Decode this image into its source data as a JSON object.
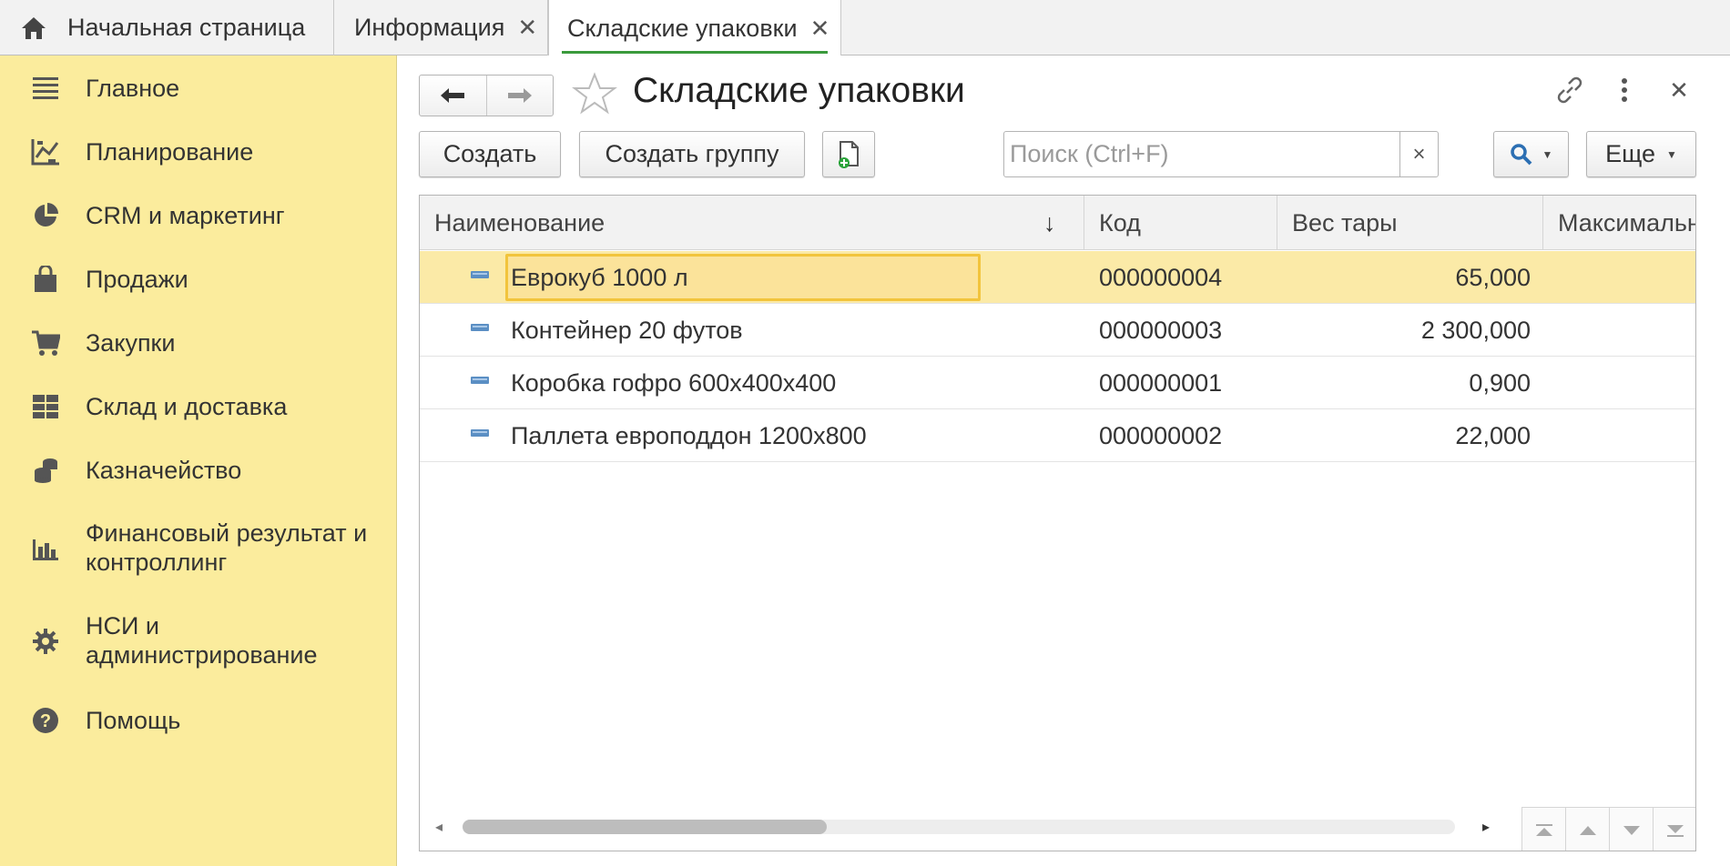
{
  "tabs": [
    {
      "label": "Начальная страница",
      "icon": "home-icon",
      "closable": false
    },
    {
      "label": "Информация",
      "closable": true
    },
    {
      "label": "Складские упаковки",
      "closable": true,
      "active": true
    }
  ],
  "sidebar": {
    "items": [
      {
        "label": "Главное",
        "icon": "menu-icon"
      },
      {
        "label": "Планирование",
        "icon": "planning-icon"
      },
      {
        "label": "CRM и маркетинг",
        "icon": "pie-chart-icon"
      },
      {
        "label": "Продажи",
        "icon": "shopping-bag-icon"
      },
      {
        "label": "Закупки",
        "icon": "cart-icon"
      },
      {
        "label": "Склад и доставка",
        "icon": "warehouse-grid-icon"
      },
      {
        "label": "Казначейство",
        "icon": "coins-icon"
      },
      {
        "label_line1": "Финансовый результат и",
        "label_line2": "контроллинг",
        "icon": "bar-chart-icon"
      },
      {
        "label_line1": "НСИ и",
        "label_line2": "администрирование",
        "icon": "gear-icon"
      },
      {
        "label": "Помощь",
        "icon": "help-icon"
      }
    ]
  },
  "form": {
    "title": "Складские упаковки",
    "create_label": "Создать",
    "create_group_label": "Создать группу",
    "more_label": "Еще",
    "search_placeholder": "Поиск (Ctrl+F)",
    "search_value": "",
    "clear_label": "×",
    "close_label": "×"
  },
  "table": {
    "columns": [
      "Наименование",
      "Код",
      "Вес тары",
      "Максимальн"
    ],
    "sort_indicator": "↓",
    "rows": [
      {
        "name": "Еврокуб 1000 л",
        "code": "000000004",
        "weight": "65,000",
        "selected": true
      },
      {
        "name": "Контейнер 20 футов",
        "code": "000000003",
        "weight": "2 300,000"
      },
      {
        "name": "Коробка гофро 600x400x400",
        "code": "000000001",
        "weight": "0,900"
      },
      {
        "name": "Паллета европоддон 1200x800",
        "code": "000000002",
        "weight": "22,000"
      }
    ]
  },
  "colors": {
    "sidebar_bg": "#fbec9d",
    "selected_row": "#fbeaa7",
    "focus_border": "#f2c43c",
    "active_tab_underline": "#3a9a3c",
    "search_icon": "#2c6fb3"
  }
}
